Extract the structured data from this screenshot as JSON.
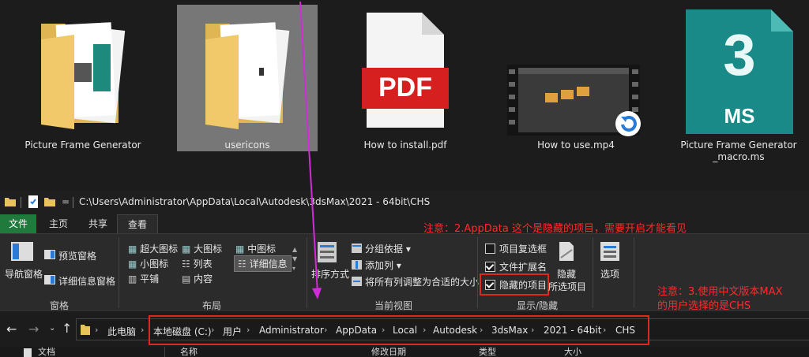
{
  "files": [
    {
      "name": "Picture Frame Generator",
      "type": "folder"
    },
    {
      "name": "usericons",
      "type": "folder"
    },
    {
      "name": "How to install.pdf",
      "type": "pdf",
      "badge": "PDF"
    },
    {
      "name": "How to use.mp4",
      "type": "video"
    },
    {
      "name_line1": "Picture Frame Generator",
      "name_line2": "_macro.ms",
      "type": "maxscript",
      "badge_num": "3",
      "badge_text": "MS"
    }
  ],
  "titlebar": {
    "path": "C:\\Users\\Administrator\\AppData\\Local\\Autodesk\\3dsMax\\2021 - 64bit\\CHS",
    "qat_arrow": "="
  },
  "tabs": [
    "文件",
    "主页",
    "共享",
    "查看"
  ],
  "ribbon": {
    "pane": {
      "nav_pane": "导航窗格",
      "preview_pane": "预览窗格",
      "details_pane": "详细信息窗格",
      "group": "窗格"
    },
    "layout": {
      "items": [
        "超大图标",
        "大图标",
        "中图标",
        "小图标",
        "列表",
        "详细信息",
        "平铺",
        "内容"
      ],
      "group": "布局"
    },
    "current_view": {
      "sort": "排序方式",
      "group_by": "分组依据",
      "add_column": "添加列",
      "fit_columns": "将所有列调整为合适的大小",
      "group": "当前视图"
    },
    "show_hide": {
      "item_checkbox": "项目复选框",
      "file_ext": "文件扩展名",
      "hidden_items": "隐藏的项目",
      "hide": "隐藏",
      "selected_items": "所选项目",
      "group": "显示/隐藏"
    },
    "options": "选项"
  },
  "annotations": {
    "note2": "注意：2.AppData 这个是隐藏的项目，需要开启才能看见",
    "note3_line1": "注意：3.使用中文版本MAX",
    "note3_line2": "的用户选择的是CHS"
  },
  "address": {
    "crumbs": [
      "此电脑",
      "本地磁盘 (C:)",
      "用户",
      "Administrator",
      "AppData",
      "Local",
      "Autodesk",
      "3dsMax",
      "2021 - 64bit",
      "CHS"
    ]
  },
  "bottom": {
    "nav_item": "文档",
    "col_name": "名称",
    "col_modified": "修改日期",
    "col_type": "类型",
    "col_size": "大小"
  },
  "colors": {
    "accent_red": "#ff2a2a",
    "tab_file_green": "#1f7a3b",
    "arrow": "#d22bd8"
  }
}
